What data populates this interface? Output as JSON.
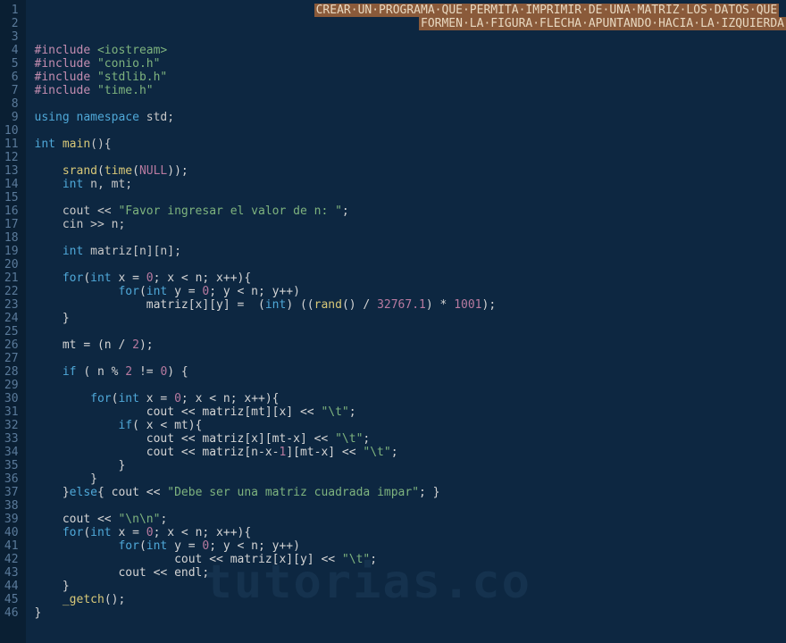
{
  "watermark": "tutorias.co",
  "comment_line1": "CREAR·UN·PROGRAMA·QUE·PERMITA·IMPRIMIR·DE·UNA·MATRIZ·LOS·DATOS·QUE",
  "comment_line2": "FORMEN·LA·FIGURA·FLECHA·APUNTANDO·HACIA·LA·IZQUIERDA",
  "lines": {
    "l4_inc": "#include",
    "l4_hdr": "<iostream>",
    "l5_inc": "#include",
    "l5_hdr": "\"conio.h\"",
    "l6_inc": "#include",
    "l6_hdr": "\"stdlib.h\"",
    "l7_inc": "#include",
    "l7_hdr": "\"time.h\"",
    "l9_using": "using",
    "l9_ns": "namespace",
    "l9_std": "std;",
    "l11_int": "int",
    "l11_main": "main",
    "l11_paren": "(){",
    "l13_srand": "srand",
    "l13_time": "time",
    "l13_null": "NULL",
    "l14_int": "int",
    "l14_vars": "n, mt;",
    "l16_cout": "cout <<",
    "l16_str": "\"Favor ingresar el valor de n: \"",
    "l17_cin": "cin >> n;",
    "l19_int": "int",
    "l19_matriz": "matriz[n][n];",
    "l21_for": "for",
    "l21_int": "int",
    "l21_rest": "x = ",
    "l21_zero": "0",
    "l21_cond": "; x < n; x++){",
    "l22_for": "for",
    "l22_int": "int",
    "l22_rest": "y = ",
    "l22_zero": "0",
    "l22_cond": "; y < n; y++)",
    "l23_assign": "matriz[x][y] =  (",
    "l23_int": "int",
    "l23_rand": "rand",
    "l23_num1": "32767.1",
    "l23_num2": "1001",
    "l26_mt": "mt = (n / ",
    "l26_two": "2",
    "l28_if": "if",
    "l28_cond": " ( n % ",
    "l28_two": "2",
    "l28_neq": " != ",
    "l28_zero": "0",
    "l28_close": ") {",
    "l30_for": "for",
    "l30_int": "int",
    "l30_rest": "x = ",
    "l30_zero": "0",
    "l30_cond": "; x < n; x++){",
    "l31_cout": "cout << matriz[mt][x] << ",
    "l31_tab": "\"\\t\"",
    "l32_if": "if",
    "l32_cond": "( x < mt){",
    "l33_cout": "cout << matriz[x][mt-x] << ",
    "l33_tab": "\"\\t\"",
    "l34_cout": "cout << matriz[n-x-",
    "l34_one": "1",
    "l34_rest": "][mt-x] << ",
    "l34_tab": "\"\\t\"",
    "l37_else": "else",
    "l37_cout": "{ cout << ",
    "l37_str": "\"Debe ser una matriz cuadrada impar\"",
    "l37_end": "; }",
    "l39_cout": "cout << ",
    "l39_str": "\"\\n\\n\"",
    "l40_for": "for",
    "l40_int": "int",
    "l40_rest": "x = ",
    "l40_zero": "0",
    "l40_cond": "; x < n; x++){",
    "l41_for": "for",
    "l41_int": "int",
    "l41_rest": "y = ",
    "l41_zero": "0",
    "l41_cond": "; y < n; y++)",
    "l42_cout": "cout << matriz[x][y] << ",
    "l42_tab": "\"\\t\"",
    "l43_cout": "cout << endl;",
    "l45_getch": "_getch",
    "l45_paren": "();"
  },
  "line_numbers": [
    1,
    2,
    3,
    4,
    5,
    6,
    7,
    8,
    9,
    10,
    11,
    12,
    13,
    14,
    15,
    16,
    17,
    18,
    19,
    20,
    21,
    22,
    23,
    24,
    25,
    26,
    27,
    28,
    29,
    30,
    31,
    32,
    33,
    34,
    35,
    36,
    37,
    38,
    39,
    40,
    41,
    42,
    43,
    44,
    45,
    46
  ]
}
